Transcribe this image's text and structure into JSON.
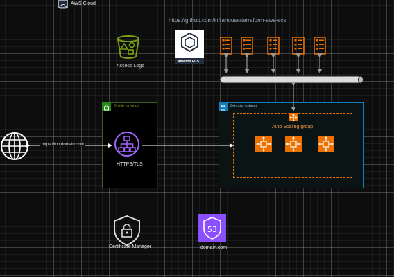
{
  "cloud": {
    "title": "AWS Cloud"
  },
  "repo_url": "https://github.com/infrahouse/terraform-aws-ecs",
  "s3": {
    "label": "Access Logs"
  },
  "ecs": {
    "label": "Amazon ECS"
  },
  "public_subnet": {
    "label": "Public subnet"
  },
  "private_subnet": {
    "label": "Private subnet"
  },
  "asg": {
    "label": "Auto Scaling group"
  },
  "alb": {
    "label": "HTTPS/TLS"
  },
  "client": {
    "link_label": "https://foo.domain.com"
  },
  "acm": {
    "label": "Certificate Manager"
  },
  "route53": {
    "label": "domain.com",
    "badge": "53"
  },
  "colors": {
    "orange": "#ed7100",
    "green": "#7aa116",
    "purple": "#8c4fff",
    "blue": "#147eba",
    "arrow": "#9a9a9a"
  }
}
